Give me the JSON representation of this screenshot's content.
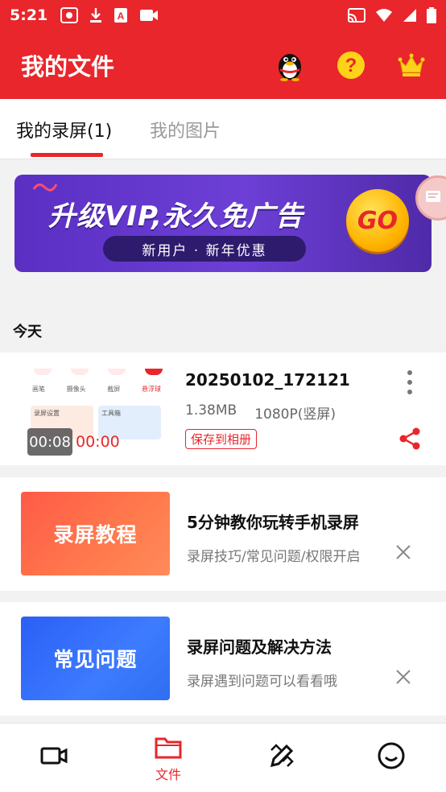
{
  "status_bar": {
    "time": "5:21",
    "icons": [
      "record-icon",
      "download-icon",
      "a-icon",
      "video-icon"
    ],
    "right_icons": [
      "cast-icon",
      "wifi-icon",
      "signal-icon",
      "battery-icon"
    ]
  },
  "app_bar": {
    "title": "我的文件",
    "actions": [
      "qq-penguin-icon",
      "help-icon",
      "crown-icon"
    ]
  },
  "tabs": [
    {
      "label": "我的录屏(1)",
      "active": true
    },
    {
      "label": "我的图片",
      "active": false
    }
  ],
  "banner": {
    "title": "升级VIP,永久免广告",
    "subtitle": "新用户 · 新年优惠",
    "go_label": "GO"
  },
  "section": {
    "label": "今天"
  },
  "video": {
    "name": "20250102_172121",
    "size": "1.38MB",
    "resolution": "1080P(竖屏)",
    "save_label": "保存到相册",
    "duration_dark": "00:08",
    "duration_red": "00:00",
    "thumb_labels": [
      "画笔",
      "摄像头",
      "截屏",
      "悬浮球"
    ],
    "thumb_box1": "录屏设置",
    "thumb_box2": "工具箱"
  },
  "promos": [
    {
      "image_label": "录屏教程",
      "title": "5分钟教你玩转手机录屏",
      "subtitle": "录屏技巧/常见问题/权限开启",
      "color": "#ff5a47"
    },
    {
      "image_label": "常见问题",
      "title": "录屏问题及解决方法",
      "subtitle": "录屏遇到问题可以看看哦",
      "color": "#2f6ef0"
    }
  ],
  "bottom_nav": [
    {
      "icon": "video-camera-icon",
      "label": ""
    },
    {
      "icon": "folder-icon",
      "label": "文件",
      "active": true
    },
    {
      "icon": "edit-tools-icon",
      "label": ""
    },
    {
      "icon": "smile-icon",
      "label": ""
    }
  ],
  "colors": {
    "accent": "#e8262b"
  }
}
